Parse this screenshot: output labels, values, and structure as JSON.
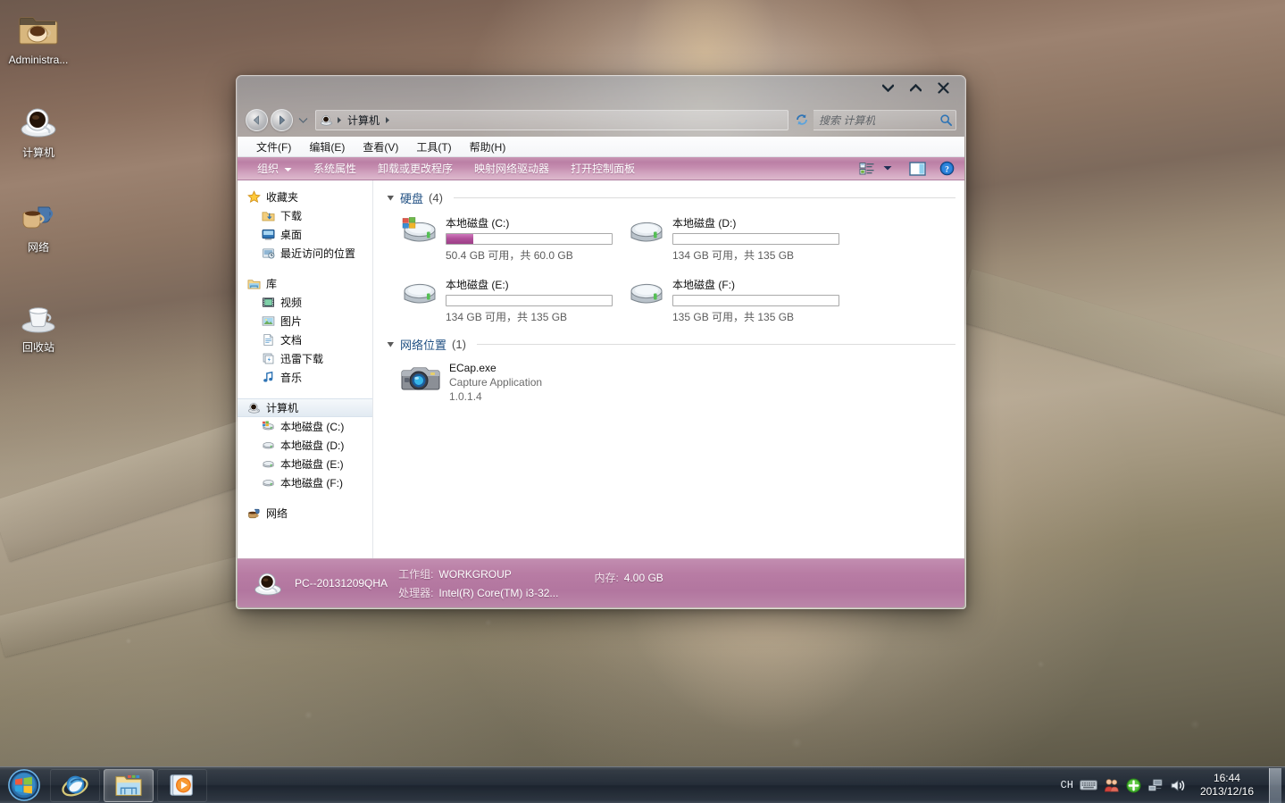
{
  "desktop": {
    "icons": [
      {
        "label": "Administra...",
        "icon": "folder-coffee-icon"
      },
      {
        "label": "计算机",
        "icon": "computer-coffee-icon"
      },
      {
        "label": "网络",
        "icon": "network-coffee-icon"
      },
      {
        "label": "回收站",
        "icon": "recycle-bin-coffee-icon"
      }
    ]
  },
  "window": {
    "title_buttons": {
      "minimize": "▼",
      "maximize": "▲",
      "close": "✕"
    },
    "address": {
      "computer_icon": "computer-icon",
      "crumbs": [
        "计算机"
      ],
      "separator": "▶"
    },
    "search": {
      "placeholder": "搜索 计算机"
    },
    "menubar": [
      {
        "label": "文件(F)"
      },
      {
        "label": "编辑(E)"
      },
      {
        "label": "查看(V)"
      },
      {
        "label": "工具(T)"
      },
      {
        "label": "帮助(H)"
      }
    ],
    "commandbar": {
      "items": [
        {
          "label": "组织",
          "has_arrow": true
        },
        {
          "label": "系统属性",
          "has_arrow": false
        },
        {
          "label": "卸载或更改程序",
          "has_arrow": false
        },
        {
          "label": "映射网络驱动器",
          "has_arrow": false
        },
        {
          "label": "打开控制面板",
          "has_arrow": false
        }
      ],
      "right_icons": [
        "view-options-icon",
        "chevron-down-icon",
        "preview-pane-icon",
        "help-icon"
      ]
    },
    "navpane": {
      "groups": [
        {
          "header": {
            "label": "收藏夹",
            "icon": "star-icon"
          },
          "items": [
            {
              "label": "下载",
              "icon": "downloads-icon"
            },
            {
              "label": "桌面",
              "icon": "desktop-icon"
            },
            {
              "label": "最近访问的位置",
              "icon": "recent-places-icon"
            }
          ]
        },
        {
          "header": {
            "label": "库",
            "icon": "library-icon"
          },
          "items": [
            {
              "label": "视频",
              "icon": "video-icon"
            },
            {
              "label": "图片",
              "icon": "pictures-icon"
            },
            {
              "label": "文档",
              "icon": "documents-icon"
            },
            {
              "label": "迅雷下载",
              "icon": "thunder-download-icon"
            },
            {
              "label": "音乐",
              "icon": "music-icon"
            }
          ]
        },
        {
          "header": {
            "label": "计算机",
            "icon": "computer-icon",
            "selected": true
          },
          "items": [
            {
              "label": "本地磁盘 (C:)",
              "icon": "system-drive-icon"
            },
            {
              "label": "本地磁盘 (D:)",
              "icon": "drive-icon"
            },
            {
              "label": "本地磁盘 (E:)",
              "icon": "drive-icon"
            },
            {
              "label": "本地磁盘 (F:)",
              "icon": "drive-icon"
            }
          ]
        },
        {
          "header": {
            "label": "网络",
            "icon": "network-icon"
          },
          "items": []
        }
      ]
    },
    "content": {
      "groups": [
        {
          "title": "硬盘",
          "count": "(4)",
          "type": "drives",
          "drives": [
            {
              "name": "本地磁盘 (C:)",
              "free_text": "50.4 GB 可用，共 60.0 GB",
              "used_percent": 16,
              "bar_color": "#b1519b",
              "icon": "system-drive-icon"
            },
            {
              "name": "本地磁盘 (D:)",
              "free_text": "134 GB 可用，共 135 GB",
              "used_percent": 0,
              "bar_color": "#b1519b",
              "icon": "drive-icon"
            },
            {
              "name": "本地磁盘 (E:)",
              "free_text": "134 GB 可用，共 135 GB",
              "used_percent": 0,
              "bar_color": "#b1519b",
              "icon": "drive-icon"
            },
            {
              "name": "本地磁盘 (F:)",
              "free_text": "135 GB 可用，共 135 GB",
              "used_percent": 0,
              "bar_color": "#b1519b",
              "icon": "drive-icon"
            }
          ]
        },
        {
          "title": "网络位置",
          "count": "(1)",
          "type": "network",
          "items": [
            {
              "name": "ECap.exe",
              "desc": "Capture Application",
              "version": "1.0.1.4",
              "icon": "camera-icon"
            }
          ]
        }
      ]
    },
    "details": {
      "icon": "computer-coffee-icon",
      "pc_name": "PC--20131209QHA",
      "workgroup_label": "工作组:",
      "workgroup_value": "WORKGROUP",
      "memory_label": "内存:",
      "memory_value": "4.00 GB",
      "cpu_label": "处理器:",
      "cpu_value": "Intel(R) Core(TM) i3-32..."
    }
  },
  "taskbar": {
    "start": "start-orb",
    "items": [
      {
        "name": "internet-explorer",
        "active": false
      },
      {
        "name": "windows-explorer",
        "active": true
      },
      {
        "name": "media-player",
        "active": false
      }
    ],
    "tray": {
      "language": "CH",
      "icons": [
        "keyboard-icon",
        "people-icon",
        "green-plus-icon",
        "network-icon",
        "volume-icon"
      ]
    },
    "clock": {
      "time": "16:44",
      "date": "2013/12/16"
    }
  },
  "colors": {
    "accent_pink": "#bb7fa5",
    "details_pink": "#b2769f",
    "group_title_blue": "#1f4f82",
    "bar_magenta": "#b1519b"
  }
}
